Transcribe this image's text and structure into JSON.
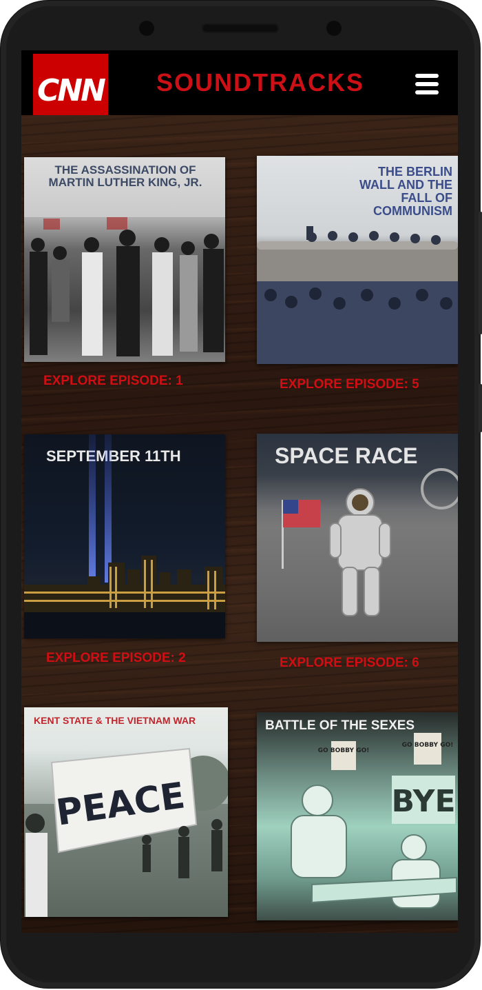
{
  "header": {
    "logo_text": "CNN",
    "title": "SOUNDTRACKS",
    "menu_icon": "hamburger-menu-icon"
  },
  "colors": {
    "accent_red": "#cc1016",
    "logo_red": "#cc0000",
    "header_bg": "#000000"
  },
  "episodes": [
    {
      "cover_title": "THE ASSASSINATION OF MARTIN LUTHER KING, JR.",
      "explore_label": "EXPLORE EPISODE: 1"
    },
    {
      "cover_title": "THE BERLIN WALL AND THE FALL OF COMMUNISM",
      "explore_label": "EXPLORE EPISODE: 5"
    },
    {
      "cover_title": "SEPTEMBER 11TH",
      "explore_label": "EXPLORE EPISODE: 2"
    },
    {
      "cover_title": "SPACE RACE",
      "explore_label": "EXPLORE EPISODE: 6"
    },
    {
      "cover_title": "KENT STATE & THE VIETNAM WAR",
      "explore_label": ""
    },
    {
      "cover_title": "BATTLE OF THE SEXES",
      "explore_label": ""
    }
  ],
  "cover_art_text": {
    "peace_banner": "PEACE",
    "sign_go_bobby_1": "GO BOBBY GO!",
    "sign_go_bobby_2": "GO BOBBY GO!",
    "sign_bye": "BYE"
  }
}
